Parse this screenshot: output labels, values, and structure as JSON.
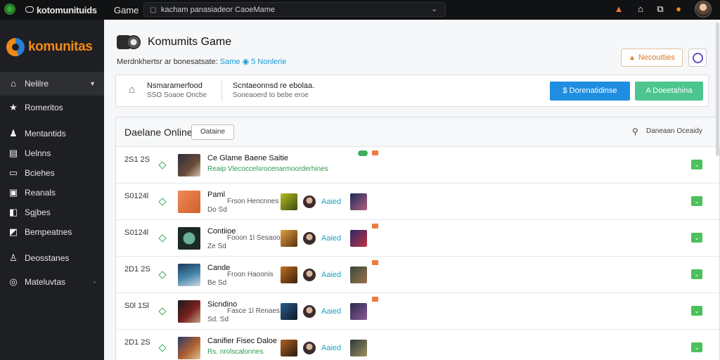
{
  "topbar": {
    "app_name": "kotomunituids",
    "game_tab": "Game",
    "search_text": "kacham panasiadeor CaoeMame",
    "icons": [
      "alert-icon",
      "home-icon",
      "external-icon",
      "notification-icon"
    ]
  },
  "sidebar": {
    "logo": "komunitas",
    "items": [
      {
        "label": "Nelilre",
        "icon": "home-icon",
        "active": true
      },
      {
        "label": "Romeritos",
        "icon": "star-icon"
      },
      {
        "label": "Mentantids",
        "icon": "user-icon"
      },
      {
        "label": "Uelnns",
        "icon": "calendar-icon"
      },
      {
        "label": "Bciehes",
        "icon": "chat-icon"
      },
      {
        "label": "Reanals",
        "icon": "reports-icon"
      },
      {
        "label": "Sgjbes",
        "icon": "groups-icon"
      },
      {
        "label": "Bempeatnes",
        "icon": "games-icon"
      },
      {
        "label": "Deosstanes",
        "icon": "person-icon"
      },
      {
        "label": "Mateluvtas",
        "icon": "search-icon"
      }
    ]
  },
  "header": {
    "title": "Komumits Game",
    "subline_text": "Merdnkhertsr ar bonesatsate:",
    "subline_link": "Same",
    "subline_badge": "5 Nonlerie",
    "notif_button": "Necoutties"
  },
  "infobar": {
    "block1_title": "Nsmaramerfood",
    "block1_sub": "SSO Soaoe Oncbe",
    "block2_title": "Scntaeonnsd re ebolaa.",
    "block2_sub": "Soneaoerd to bebe eroe",
    "blue_button": "Dorenatidinse",
    "green_button": "Doeetahina"
  },
  "list": {
    "title": "Daelane Online",
    "filter_button": "Oataine",
    "search_label": "Daneaan Oceaidy",
    "rows": [
      {
        "time": "2S1 2S",
        "name": "Ce Glame Baene Saitie",
        "sub": "",
        "green_sub": "Reaip Vlecoccelsrocenarmoorderhines",
        "sub2": "",
        "added": "",
        "show_avatars": false,
        "badges": true
      },
      {
        "time": "S0124l",
        "name": "Paml",
        "sub": "Frson Hencnnes",
        "green_sub": "",
        "sub2": "Do Sd",
        "added": "Aaied",
        "show_avatars": true,
        "badges": false
      },
      {
        "time": "S0124l",
        "name": "Contiioe",
        "sub": "Fooon 1l Sesaooe",
        "green_sub": "",
        "sub2": "Ze Sd",
        "added": "Aaied",
        "show_avatars": true,
        "badges": true
      },
      {
        "time": "2D1 2S",
        "name": "Cande",
        "sub": "Froon Haoonis",
        "green_sub": "",
        "sub2": "Be Sd",
        "added": "Aaied",
        "show_avatars": true,
        "badges": true
      },
      {
        "time": "S0l 1Sl",
        "name": "Sicndino",
        "sub": "Fasce 1l Renaes",
        "green_sub": "",
        "sub2": "Sd. Sd",
        "added": "Aaied",
        "show_avatars": true,
        "badges": true
      },
      {
        "time": "2D1 2S",
        "name": "Canifier Fisec Daloe",
        "sub": "",
        "green_sub": "Rs. nrolscalonnes",
        "sub2": "",
        "added": "Aaied",
        "show_avatars": true,
        "badges": false
      }
    ]
  },
  "colors": {
    "accent_orange": "#f28a16",
    "accent_blue": "#1f8de0",
    "accent_green": "#4cc58f",
    "link_teal": "#1aa4c4"
  }
}
